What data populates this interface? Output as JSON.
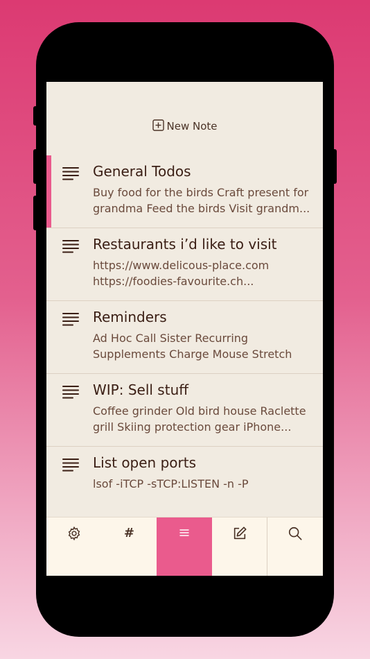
{
  "header": {
    "new_note_label": "New Note"
  },
  "notes": [
    {
      "title": "General Todos",
      "preview": "Buy food for the birds Craft present for grandma Feed the birds Visit grandm...",
      "active": true
    },
    {
      "title": "Restaurants i’d like to visit",
      "preview": "https://www.delicous-place.com https://foodies-favourite.ch...",
      "active": false
    },
    {
      "title": "Reminders",
      "preview": "Ad Hoc Call Sister Recurring Supplements Charge Mouse Stretch",
      "active": false
    },
    {
      "title": "WIP: Sell stuff",
      "preview": "Coffee grinder Old bird house Raclette grill Skiing protection gear iPhone...",
      "active": false
    },
    {
      "title": "List open ports",
      "preview": "lsof -iTCP -sTCP:LISTEN -n -P",
      "active": false
    }
  ],
  "tabbar": {
    "tabs": [
      {
        "name": "settings",
        "icon": "gear-icon"
      },
      {
        "name": "tags",
        "icon": "hash-icon",
        "label": "#"
      },
      {
        "name": "notes",
        "icon": "list-icon",
        "active": true
      },
      {
        "name": "compose",
        "icon": "compose-icon"
      },
      {
        "name": "search",
        "icon": "search-icon"
      }
    ]
  },
  "colors": {
    "accent": "#ea5b8d",
    "background": "#f1ebe1",
    "tabbar": "#fdf6ea",
    "text": "#3a1e14"
  }
}
